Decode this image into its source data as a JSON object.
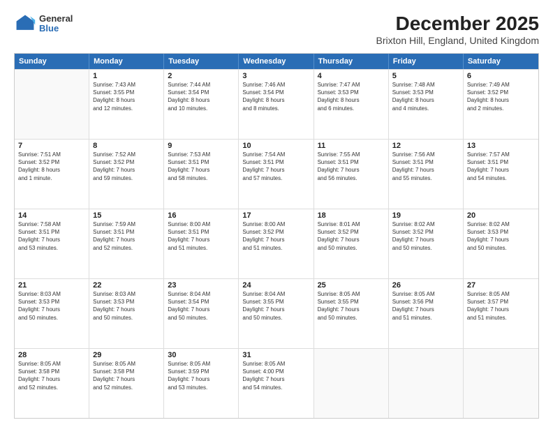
{
  "header": {
    "logo_general": "General",
    "logo_blue": "Blue",
    "title": "December 2025",
    "subtitle": "Brixton Hill, England, United Kingdom"
  },
  "calendar": {
    "days_of_week": [
      "Sunday",
      "Monday",
      "Tuesday",
      "Wednesday",
      "Thursday",
      "Friday",
      "Saturday"
    ],
    "rows": [
      [
        {
          "day": "",
          "info": ""
        },
        {
          "day": "1",
          "info": "Sunrise: 7:43 AM\nSunset: 3:55 PM\nDaylight: 8 hours\nand 12 minutes."
        },
        {
          "day": "2",
          "info": "Sunrise: 7:44 AM\nSunset: 3:54 PM\nDaylight: 8 hours\nand 10 minutes."
        },
        {
          "day": "3",
          "info": "Sunrise: 7:46 AM\nSunset: 3:54 PM\nDaylight: 8 hours\nand 8 minutes."
        },
        {
          "day": "4",
          "info": "Sunrise: 7:47 AM\nSunset: 3:53 PM\nDaylight: 8 hours\nand 6 minutes."
        },
        {
          "day": "5",
          "info": "Sunrise: 7:48 AM\nSunset: 3:53 PM\nDaylight: 8 hours\nand 4 minutes."
        },
        {
          "day": "6",
          "info": "Sunrise: 7:49 AM\nSunset: 3:52 PM\nDaylight: 8 hours\nand 2 minutes."
        }
      ],
      [
        {
          "day": "7",
          "info": "Sunrise: 7:51 AM\nSunset: 3:52 PM\nDaylight: 8 hours\nand 1 minute."
        },
        {
          "day": "8",
          "info": "Sunrise: 7:52 AM\nSunset: 3:52 PM\nDaylight: 7 hours\nand 59 minutes."
        },
        {
          "day": "9",
          "info": "Sunrise: 7:53 AM\nSunset: 3:51 PM\nDaylight: 7 hours\nand 58 minutes."
        },
        {
          "day": "10",
          "info": "Sunrise: 7:54 AM\nSunset: 3:51 PM\nDaylight: 7 hours\nand 57 minutes."
        },
        {
          "day": "11",
          "info": "Sunrise: 7:55 AM\nSunset: 3:51 PM\nDaylight: 7 hours\nand 56 minutes."
        },
        {
          "day": "12",
          "info": "Sunrise: 7:56 AM\nSunset: 3:51 PM\nDaylight: 7 hours\nand 55 minutes."
        },
        {
          "day": "13",
          "info": "Sunrise: 7:57 AM\nSunset: 3:51 PM\nDaylight: 7 hours\nand 54 minutes."
        }
      ],
      [
        {
          "day": "14",
          "info": "Sunrise: 7:58 AM\nSunset: 3:51 PM\nDaylight: 7 hours\nand 53 minutes."
        },
        {
          "day": "15",
          "info": "Sunrise: 7:59 AM\nSunset: 3:51 PM\nDaylight: 7 hours\nand 52 minutes."
        },
        {
          "day": "16",
          "info": "Sunrise: 8:00 AM\nSunset: 3:51 PM\nDaylight: 7 hours\nand 51 minutes."
        },
        {
          "day": "17",
          "info": "Sunrise: 8:00 AM\nSunset: 3:52 PM\nDaylight: 7 hours\nand 51 minutes."
        },
        {
          "day": "18",
          "info": "Sunrise: 8:01 AM\nSunset: 3:52 PM\nDaylight: 7 hours\nand 50 minutes."
        },
        {
          "day": "19",
          "info": "Sunrise: 8:02 AM\nSunset: 3:52 PM\nDaylight: 7 hours\nand 50 minutes."
        },
        {
          "day": "20",
          "info": "Sunrise: 8:02 AM\nSunset: 3:53 PM\nDaylight: 7 hours\nand 50 minutes."
        }
      ],
      [
        {
          "day": "21",
          "info": "Sunrise: 8:03 AM\nSunset: 3:53 PM\nDaylight: 7 hours\nand 50 minutes."
        },
        {
          "day": "22",
          "info": "Sunrise: 8:03 AM\nSunset: 3:53 PM\nDaylight: 7 hours\nand 50 minutes."
        },
        {
          "day": "23",
          "info": "Sunrise: 8:04 AM\nSunset: 3:54 PM\nDaylight: 7 hours\nand 50 minutes."
        },
        {
          "day": "24",
          "info": "Sunrise: 8:04 AM\nSunset: 3:55 PM\nDaylight: 7 hours\nand 50 minutes."
        },
        {
          "day": "25",
          "info": "Sunrise: 8:05 AM\nSunset: 3:55 PM\nDaylight: 7 hours\nand 50 minutes."
        },
        {
          "day": "26",
          "info": "Sunrise: 8:05 AM\nSunset: 3:56 PM\nDaylight: 7 hours\nand 51 minutes."
        },
        {
          "day": "27",
          "info": "Sunrise: 8:05 AM\nSunset: 3:57 PM\nDaylight: 7 hours\nand 51 minutes."
        }
      ],
      [
        {
          "day": "28",
          "info": "Sunrise: 8:05 AM\nSunset: 3:58 PM\nDaylight: 7 hours\nand 52 minutes."
        },
        {
          "day": "29",
          "info": "Sunrise: 8:05 AM\nSunset: 3:58 PM\nDaylight: 7 hours\nand 52 minutes."
        },
        {
          "day": "30",
          "info": "Sunrise: 8:05 AM\nSunset: 3:59 PM\nDaylight: 7 hours\nand 53 minutes."
        },
        {
          "day": "31",
          "info": "Sunrise: 8:05 AM\nSunset: 4:00 PM\nDaylight: 7 hours\nand 54 minutes."
        },
        {
          "day": "",
          "info": ""
        },
        {
          "day": "",
          "info": ""
        },
        {
          "day": "",
          "info": ""
        }
      ]
    ]
  }
}
